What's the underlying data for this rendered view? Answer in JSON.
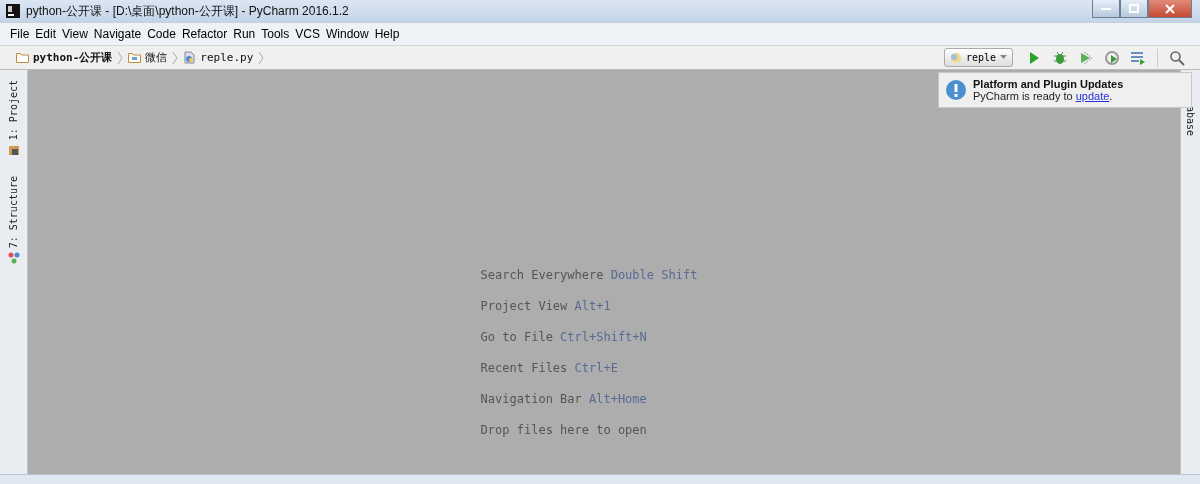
{
  "window": {
    "title": "python-公开课 - [D:\\桌面\\python-公开课] - PyCharm 2016.1.2"
  },
  "menu": [
    "File",
    "Edit",
    "View",
    "Navigate",
    "Code",
    "Refactor",
    "Run",
    "Tools",
    "VCS",
    "Window",
    "Help"
  ],
  "breadcrumbs": [
    {
      "label": "python-公开课",
      "kind": "folder",
      "bold": true
    },
    {
      "label": "微信",
      "kind": "package",
      "bold": false
    },
    {
      "label": "reple.py",
      "kind": "file",
      "bold": false
    }
  ],
  "run_config": {
    "label": "reple"
  },
  "left_tabs": [
    {
      "label": "1: Project",
      "kind": "project"
    },
    {
      "label": "7: Structure",
      "kind": "structure"
    }
  ],
  "right_tabs": [
    {
      "label": "abase"
    }
  ],
  "notification": {
    "title": "Platform and Plugin Updates",
    "text": "PyCharm is ready to ",
    "link": "update",
    "after": "."
  },
  "hints": [
    {
      "text": "Search Everywhere",
      "shortcut": "Double Shift"
    },
    {
      "text": "Project View",
      "shortcut": "Alt+1"
    },
    {
      "text": "Go to File",
      "shortcut": "Ctrl+Shift+N"
    },
    {
      "text": "Recent Files",
      "shortcut": "Ctrl+E"
    },
    {
      "text": "Navigation Bar",
      "shortcut": "Alt+Home"
    },
    {
      "text": "Drop files here to open"
    }
  ]
}
